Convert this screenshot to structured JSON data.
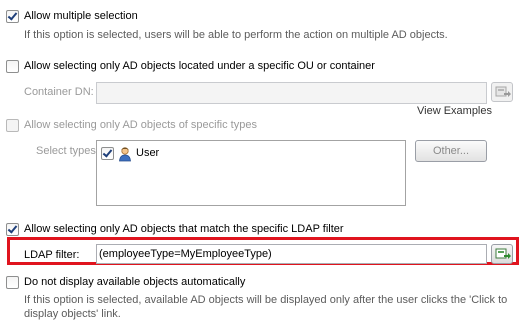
{
  "options": {
    "multi": {
      "label": "Allow multiple selection",
      "checked": true,
      "description": "If this option is selected, users will be able to perform the action on multiple AD objects."
    },
    "ou": {
      "label": "Allow selecting only AD objects located under a specific OU or container",
      "checked": false
    },
    "container": {
      "label": "Container DN:",
      "value": "",
      "view_examples": "View Examples"
    },
    "types": {
      "label": "Allow selecting only AD objects of specific types",
      "checked": false,
      "select_label": "Select types:",
      "items": [
        {
          "label": "User",
          "checked": true,
          "icon": "user-icon"
        }
      ],
      "other_button": "Other..."
    },
    "ldap": {
      "label": "Allow selecting only AD objects that match the specific LDAP filter",
      "checked": true,
      "filter_label": "LDAP filter:",
      "filter_value": "(employeeType=MyEmployeeType)",
      "highlight_color": "#e0141e"
    },
    "auto": {
      "label": "Do not display available objects automatically",
      "checked": false,
      "description": "If this option is selected, available AD objects will be displayed only after the user clicks the 'Click to display objects' link."
    }
  }
}
